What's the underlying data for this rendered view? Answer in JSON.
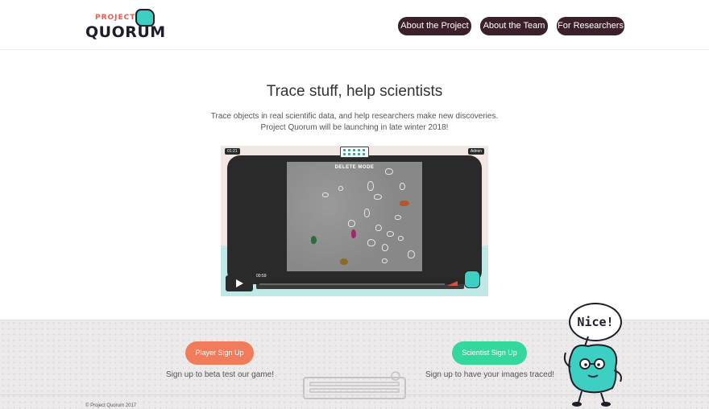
{
  "header": {
    "logo_small": "PROJECT",
    "logo_main": "QUORUM",
    "nav": [
      {
        "label": "About the Project"
      },
      {
        "label": "About the Team"
      },
      {
        "label": "For Researchers"
      }
    ]
  },
  "hero": {
    "title": "Trace stuff, help scientists",
    "description": "Trace objects in real scientific data, and help researchers make new discoveries. Project Quorum will be launching in late winter 2018!"
  },
  "video": {
    "timer": "01:21",
    "user": "Admin",
    "mode": "DELETE MODE",
    "current_time": "00:59",
    "progress": 0.5
  },
  "signup": {
    "player_button": "Player Sign Up",
    "player_text": "Sign up to beta test our game!",
    "scientist_button": "Scientist Sign Up",
    "scientist_text": "Sign up to have your images traced!"
  },
  "mascot": {
    "speech": "Nice!"
  },
  "footer": {
    "copyright": "© Project Quorum 2017"
  },
  "colors": {
    "nav_bg": "#3b1f2b",
    "player_button": "#f07c5b",
    "scientist_button": "#34d79c",
    "mascot": "#3dcfc2",
    "logo_accent": "#ef5a4a"
  }
}
